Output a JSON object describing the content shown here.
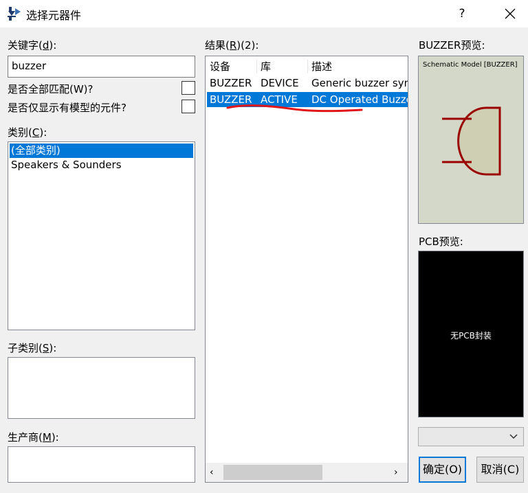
{
  "window": {
    "title": "选择元器件",
    "help_label": "?"
  },
  "keyword": {
    "label_prefix": "关键字(",
    "label_key": "d",
    "label_suffix": "):",
    "value": "buzzer"
  },
  "options": {
    "match_all_label": "是否全部匹配(W)?",
    "model_only_label": "是否仅显示有模型的元件?"
  },
  "category": {
    "label_prefix": "类别(",
    "label_key": "C",
    "label_suffix": "):",
    "items": [
      "(全部类别)",
      "Speakers & Sounders"
    ]
  },
  "subcategory": {
    "label_prefix": "子类别(",
    "label_key": "S",
    "label_suffix": "):"
  },
  "manufacturer": {
    "label_prefix": "生产商(",
    "label_key": "M",
    "label_suffix": "):"
  },
  "results": {
    "label_prefix": "结果(",
    "label_key": "R",
    "label_suffix": ")(2):",
    "columns": [
      "设备",
      "库",
      "描述"
    ],
    "rows": [
      {
        "device": "BUZZER",
        "library": "DEVICE",
        "description": "Generic buzzer sym"
      },
      {
        "device": "BUZZER",
        "library": "ACTIVE",
        "description": "DC Operated Buzze"
      }
    ]
  },
  "preview": {
    "schematic_label": "BUZZER预览:",
    "schematic_caption": "Schematic Model [BUZZER]",
    "pcb_label": "PCB预览:",
    "pcb_text": "无PCB封装"
  },
  "buttons": {
    "ok": "确定(O)",
    "cancel": "取消(C)"
  },
  "colors": {
    "selection": "#0078d7",
    "symbol_stroke": "#9b0000",
    "symbol_fill": "#cfcfb4",
    "preview_bg": "#d4d8c8",
    "annotation": "#e0161b"
  }
}
